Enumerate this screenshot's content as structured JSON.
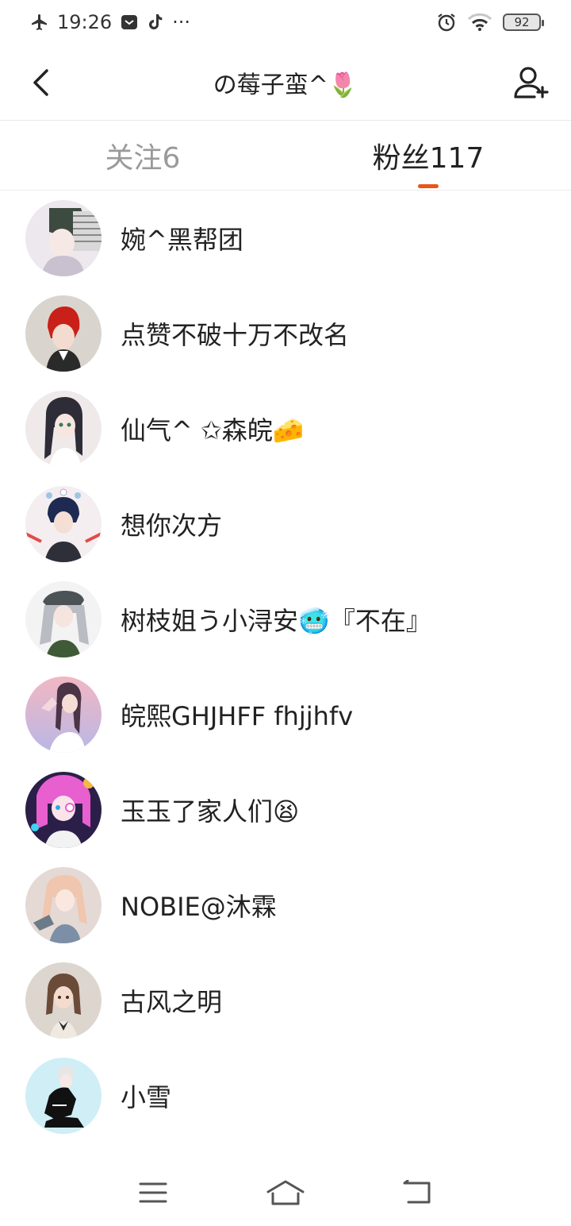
{
  "status_bar": {
    "time": "19:26",
    "more": "···",
    "battery": "92"
  },
  "header": {
    "title": "の莓子蛮^🌷"
  },
  "tabs": [
    {
      "label": "关注6"
    },
    {
      "label": "粉丝117"
    }
  ],
  "colors": {
    "accent": "#e8561b",
    "text": "#222222",
    "inactive": "#9a9a9a"
  },
  "fans": [
    {
      "name": "婉^黑帮团"
    },
    {
      "name": "点赞不破十万不改名"
    },
    {
      "name": "仙气^ ✩森皖🧀"
    },
    {
      "name": "想你次方"
    },
    {
      "name": "树枝姐う小浔安🥶『不在』"
    },
    {
      "name": "皖熙GHJHFF fhjjhfv"
    },
    {
      "name": "玉玉了家人们😫"
    },
    {
      "name": "NOBIE@沐霖"
    },
    {
      "name": "古风之明"
    },
    {
      "name": "小雪"
    }
  ],
  "icons": {
    "back": "chevron-left-icon",
    "add_user": "add-user-icon",
    "menu": "menu-icon",
    "home": "home-icon",
    "return": "return-icon"
  }
}
